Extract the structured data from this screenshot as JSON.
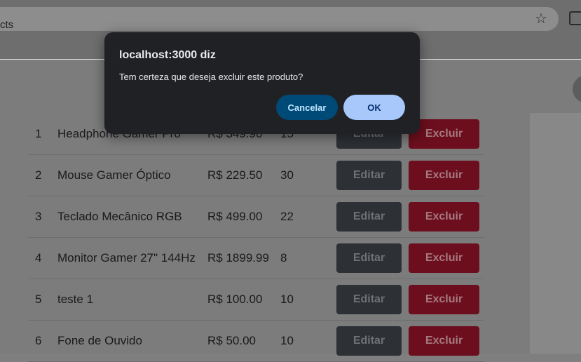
{
  "browser": {
    "url_fragment": "cts",
    "bookmark_icon": "star-icon",
    "extensions_icon": "puzzle-icon"
  },
  "dialog": {
    "title": "localhost:3000 diz",
    "message": "Tem certeza que deseja excluir este produto?",
    "cancel_label": "Cancelar",
    "ok_label": "OK"
  },
  "products": [
    {
      "id": "1",
      "name": "Headphone Gamer Pro",
      "price": "R$ 349.90",
      "qty": "15",
      "edit_label": "Editar",
      "delete_label": "Excluir"
    },
    {
      "id": "2",
      "name": "Mouse Gamer Óptico",
      "price": "R$ 229.50",
      "qty": "30",
      "edit_label": "Editar",
      "delete_label": "Excluir"
    },
    {
      "id": "3",
      "name": "Teclado Mecânico RGB",
      "price": "R$ 499.00",
      "qty": "22",
      "edit_label": "Editar",
      "delete_label": "Excluir"
    },
    {
      "id": "4",
      "name": "Monitor Gamer 27\" 144Hz",
      "price": "R$ 1899.99",
      "qty": "8",
      "edit_label": "Editar",
      "delete_label": "Excluir"
    },
    {
      "id": "5",
      "name": "teste 1",
      "price": "R$ 100.00",
      "qty": "10",
      "edit_label": "Editar",
      "delete_label": "Excluir"
    },
    {
      "id": "6",
      "name": "Fone de Ouvido",
      "price": "R$ 50.00",
      "qty": "10",
      "edit_label": "Editar",
      "delete_label": "Excluir"
    }
  ],
  "colors": {
    "dialog_bg": "#202124",
    "cancel_bg": "#004a77",
    "ok_bg": "#a8c7fa",
    "edit_btn": "#2d3035",
    "delete_btn": "#6c0e1d"
  }
}
